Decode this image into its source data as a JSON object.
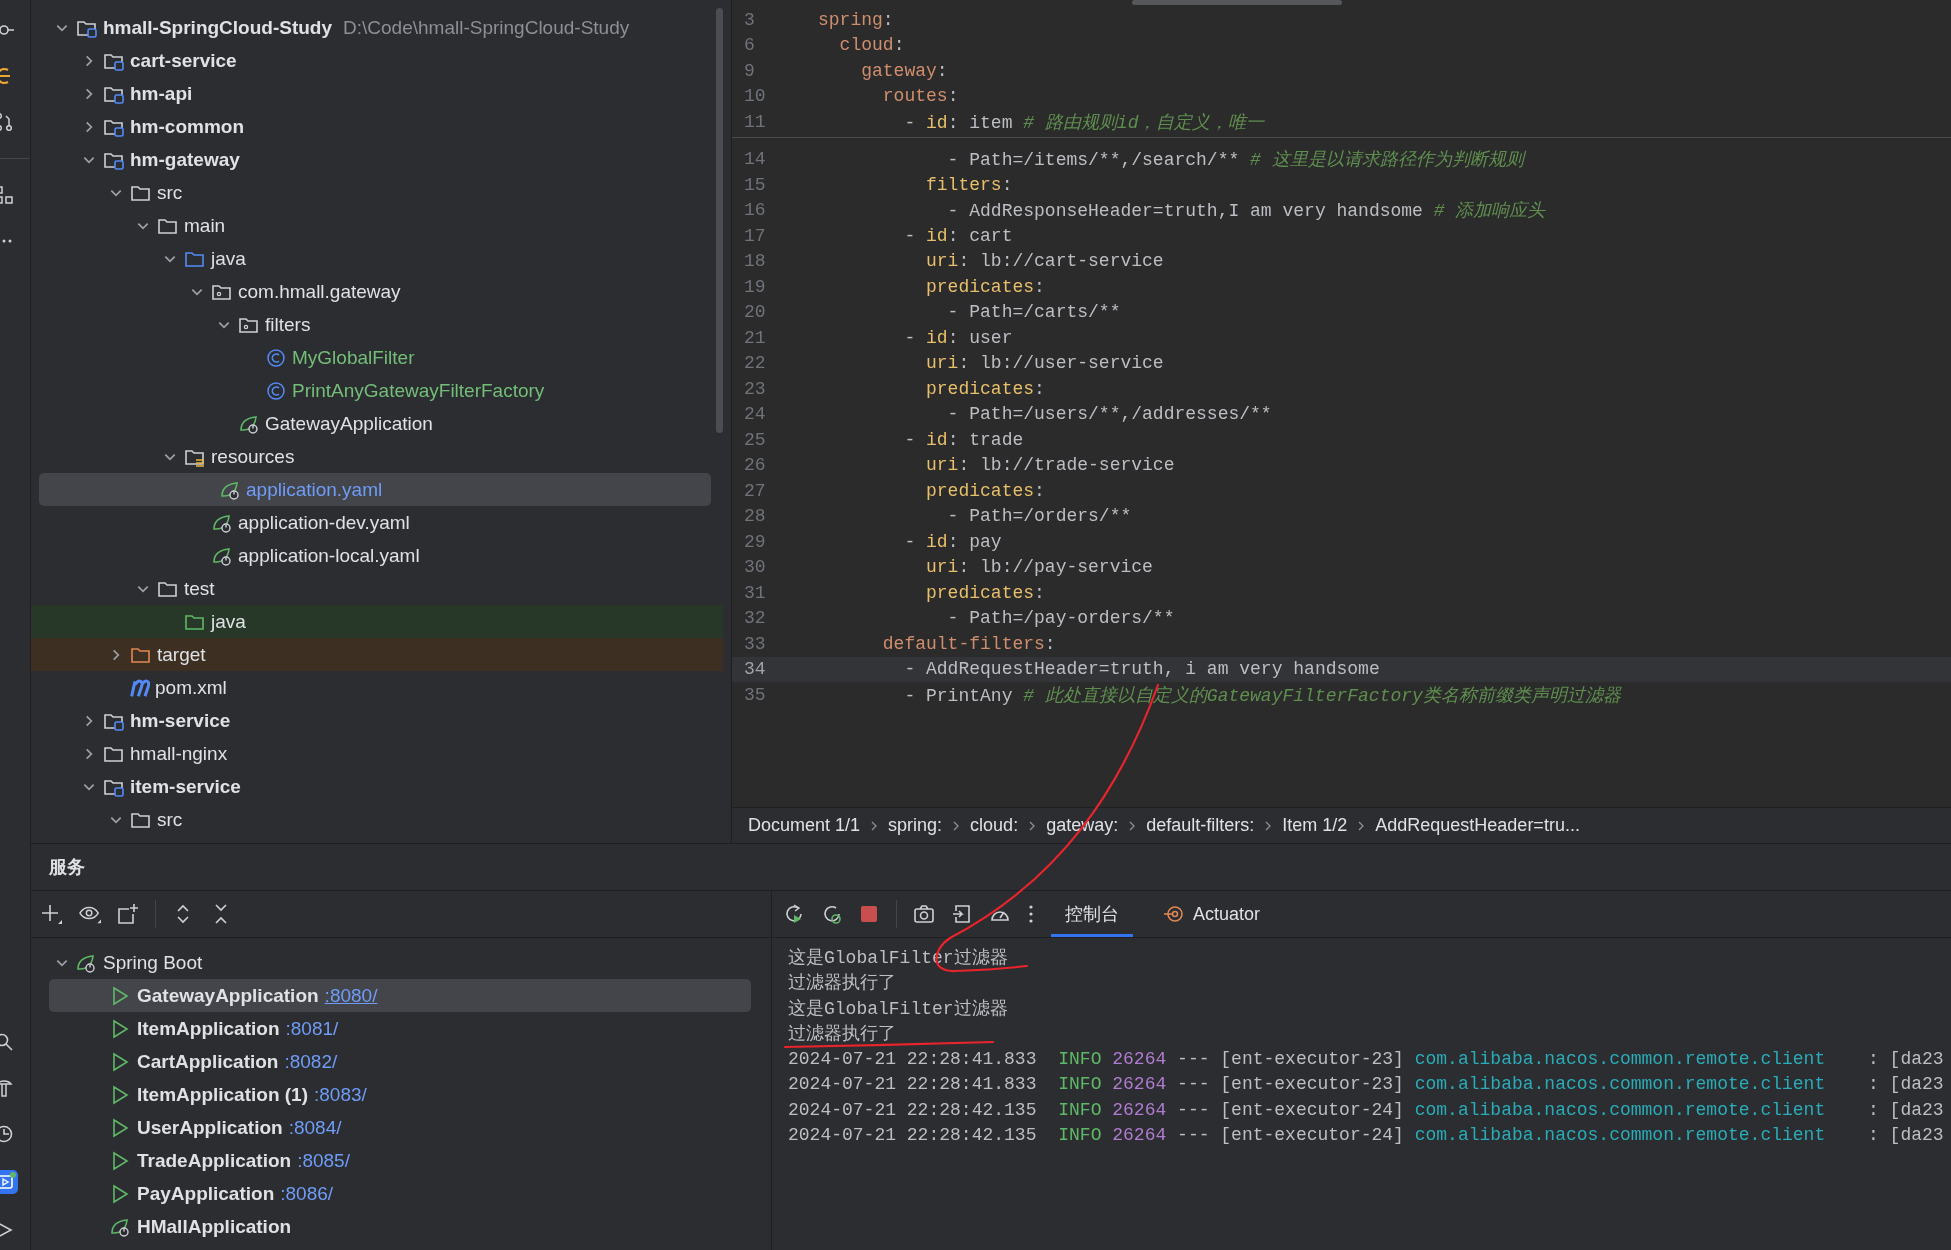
{
  "project_tree": [
    {
      "label": "hmall-SpringCloud-Study",
      "hint": "D:\\Code\\hmall-SpringCloud-Study",
      "kind": "module",
      "expanded": true,
      "selected": false,
      "children": [
        {
          "label": "cart-service",
          "kind": "module",
          "expanded": false,
          "selected": false
        },
        {
          "label": "hm-api",
          "kind": "module",
          "expanded": false,
          "selected": false
        },
        {
          "label": "hm-common",
          "kind": "module",
          "expanded": false,
          "selected": false
        },
        {
          "label": "hm-gateway",
          "kind": "module",
          "expanded": true,
          "selected": false,
          "children": [
            {
              "label": "src",
              "kind": "folder",
              "expanded": true,
              "selected": false,
              "children": [
                {
                  "label": "main",
                  "kind": "folder",
                  "expanded": true,
                  "selected": false,
                  "children": [
                    {
                      "label": "java",
                      "kind": "source-folder",
                      "expanded": true,
                      "selected": false,
                      "children": [
                        {
                          "label": "com.hmall.gateway",
                          "kind": "package",
                          "expanded": true,
                          "selected": false,
                          "children": [
                            {
                              "label": "filters",
                              "kind": "package",
                              "expanded": true,
                              "selected": false,
                              "children": [
                                {
                                  "label": "MyGlobalFilter",
                                  "kind": "class",
                                  "added": true,
                                  "modified": false,
                                  "selected": false
                                },
                                {
                                  "label": "PrintAnyGatewayFilterFactory",
                                  "kind": "class",
                                  "added": true,
                                  "modified": false,
                                  "selected": false
                                }
                              ]
                            },
                            {
                              "label": "GatewayApplication",
                              "kind": "spring-app",
                              "added": false,
                              "modified": false,
                              "selected": false
                            }
                          ]
                        }
                      ]
                    },
                    {
                      "label": "resources",
                      "kind": "resources",
                      "expanded": true,
                      "selected": false,
                      "children": [
                        {
                          "label": "application.yaml",
                          "kind": "spring-yaml",
                          "added": false,
                          "modified": true,
                          "selected": true
                        },
                        {
                          "label": "application-dev.yaml",
                          "kind": "spring-yaml",
                          "added": false,
                          "modified": false,
                          "selected": false
                        },
                        {
                          "label": "application-local.yaml",
                          "kind": "spring-yaml",
                          "added": false,
                          "modified": false,
                          "selected": false
                        }
                      ]
                    }
                  ]
                },
                {
                  "label": "test",
                  "kind": "folder",
                  "expanded": true,
                  "selected": false,
                  "children": [
                    {
                      "label": "java",
                      "kind": "test-folder",
                      "selected": false
                    }
                  ]
                }
              ]
            },
            {
              "label": "target",
              "kind": "excluded",
              "expanded": false,
              "selected": false
            },
            {
              "label": "pom.xml",
              "kind": "maven",
              "selected": false
            }
          ]
        },
        {
          "label": "hm-service",
          "kind": "module",
          "expanded": false,
          "selected": false
        },
        {
          "label": "hmall-nginx",
          "kind": "folder",
          "expanded": false,
          "selected": false
        },
        {
          "label": "item-service",
          "kind": "module",
          "expanded": true,
          "selected": false,
          "children": [
            {
              "label": "src",
              "kind": "folder",
              "expanded": true,
              "selected": false
            }
          ]
        }
      ]
    }
  ],
  "editor": {
    "sticky_lines": [
      {
        "n": "3",
        "parts": [
          {
            "t": "spring",
            "kind": "key"
          },
          {
            "t": ":",
            "kind": "text"
          }
        ]
      },
      {
        "n": "6",
        "parts": [
          {
            "t": "  cloud",
            "kind": "key"
          },
          {
            "t": ":",
            "kind": "text"
          }
        ]
      },
      {
        "n": "9",
        "parts": [
          {
            "t": "    gateway",
            "kind": "key"
          },
          {
            "t": ":",
            "kind": "text"
          }
        ]
      },
      {
        "n": "10",
        "parts": [
          {
            "t": "      routes",
            "kind": "key"
          },
          {
            "t": ":",
            "kind": "text"
          }
        ]
      },
      {
        "n": "11",
        "parts": [
          {
            "t": "        - ",
            "kind": "text"
          },
          {
            "t": "id",
            "kind": "key2"
          },
          {
            "t": ": item ",
            "kind": "text"
          },
          {
            "t": "# 路由规则id，自定义，唯一",
            "kind": "comment"
          }
        ]
      }
    ],
    "lines": [
      {
        "n": "14",
        "current": false,
        "parts": [
          {
            "t": "            - Path=/items/**,/search/** ",
            "kind": "text"
          },
          {
            "t": "# 这里是以请求路径作为判断规则",
            "kind": "comment"
          }
        ]
      },
      {
        "n": "15",
        "current": false,
        "parts": [
          {
            "t": "          filters",
            "kind": "key2"
          },
          {
            "t": ":",
            "kind": "text"
          }
        ]
      },
      {
        "n": "16",
        "current": false,
        "parts": [
          {
            "t": "            - AddResponseHeader=truth,I am very handsome ",
            "kind": "text"
          },
          {
            "t": "# 添加响应头",
            "kind": "comment"
          }
        ]
      },
      {
        "n": "17",
        "current": false,
        "parts": [
          {
            "t": "        - ",
            "kind": "text"
          },
          {
            "t": "id",
            "kind": "key2"
          },
          {
            "t": ": cart",
            "kind": "text"
          }
        ]
      },
      {
        "n": "18",
        "current": false,
        "parts": [
          {
            "t": "          uri",
            "kind": "key2"
          },
          {
            "t": ": lb://cart-service",
            "kind": "text"
          }
        ]
      },
      {
        "n": "19",
        "current": false,
        "parts": [
          {
            "t": "          predicates",
            "kind": "key2"
          },
          {
            "t": ":",
            "kind": "text"
          }
        ]
      },
      {
        "n": "20",
        "current": false,
        "parts": [
          {
            "t": "            - Path=/carts/**",
            "kind": "text"
          }
        ]
      },
      {
        "n": "21",
        "current": false,
        "parts": [
          {
            "t": "        - ",
            "kind": "text"
          },
          {
            "t": "id",
            "kind": "key2"
          },
          {
            "t": ": user",
            "kind": "text"
          }
        ]
      },
      {
        "n": "22",
        "current": false,
        "parts": [
          {
            "t": "          uri",
            "kind": "key2"
          },
          {
            "t": ": lb://user-service",
            "kind": "text"
          }
        ]
      },
      {
        "n": "23",
        "current": false,
        "parts": [
          {
            "t": "          predicates",
            "kind": "key2"
          },
          {
            "t": ":",
            "kind": "text"
          }
        ]
      },
      {
        "n": "24",
        "current": false,
        "parts": [
          {
            "t": "            - Path=/users/**,/addresses/**",
            "kind": "text"
          }
        ]
      },
      {
        "n": "25",
        "current": false,
        "parts": [
          {
            "t": "        - ",
            "kind": "text"
          },
          {
            "t": "id",
            "kind": "key2"
          },
          {
            "t": ": trade",
            "kind": "text"
          }
        ]
      },
      {
        "n": "26",
        "current": false,
        "parts": [
          {
            "t": "          uri",
            "kind": "key2"
          },
          {
            "t": ": lb://trade-service",
            "kind": "text"
          }
        ]
      },
      {
        "n": "27",
        "current": false,
        "parts": [
          {
            "t": "          predicates",
            "kind": "key2"
          },
          {
            "t": ":",
            "kind": "text"
          }
        ]
      },
      {
        "n": "28",
        "current": false,
        "parts": [
          {
            "t": "            - Path=/orders/**",
            "kind": "text"
          }
        ]
      },
      {
        "n": "29",
        "current": false,
        "parts": [
          {
            "t": "        - ",
            "kind": "text"
          },
          {
            "t": "id",
            "kind": "key2"
          },
          {
            "t": ": pay",
            "kind": "text"
          }
        ]
      },
      {
        "n": "30",
        "current": false,
        "parts": [
          {
            "t": "          uri",
            "kind": "key2"
          },
          {
            "t": ": lb://pay-service",
            "kind": "text"
          }
        ]
      },
      {
        "n": "31",
        "current": false,
        "parts": [
          {
            "t": "          predicates",
            "kind": "key2"
          },
          {
            "t": ":",
            "kind": "text"
          }
        ]
      },
      {
        "n": "32",
        "current": false,
        "parts": [
          {
            "t": "            - Path=/pay-orders/**",
            "kind": "text"
          }
        ]
      },
      {
        "n": "33",
        "current": false,
        "parts": [
          {
            "t": "      default-filters",
            "kind": "key"
          },
          {
            "t": ":",
            "kind": "text"
          }
        ]
      },
      {
        "n": "34",
        "current": true,
        "parts": [
          {
            "t": "        - AddRequestHeader=truth, i am very handsome",
            "kind": "text"
          }
        ]
      },
      {
        "n": "35",
        "current": false,
        "parts": [
          {
            "t": "        - PrintAny ",
            "kind": "text"
          },
          {
            "t": "# 此处直接以自定义的GatewayFilterFactory类名称前缀类声明过滤器",
            "kind": "comment"
          }
        ]
      }
    ]
  },
  "breadcrumb": [
    "Document 1/1",
    "spring:",
    "cloud:",
    "gateway:",
    "default-filters:",
    "Item 1/2",
    "AddRequestHeader=tru..."
  ],
  "services": {
    "title": "服务",
    "group": {
      "label": "Spring Boot",
      "expanded": true,
      "items": [
        {
          "name": "GatewayApplication",
          "port": ":8080/",
          "kind": "run-config",
          "selected": true
        },
        {
          "name": "ItemApplication",
          "port": ":8081/",
          "kind": "run-config",
          "selected": false
        },
        {
          "name": "CartApplication",
          "port": ":8082/",
          "kind": "run-config",
          "selected": false
        },
        {
          "name": "ItemApplication (1)",
          "port": ":8083/",
          "kind": "run-config",
          "selected": false
        },
        {
          "name": "UserApplication",
          "port": ":8084/",
          "kind": "run-config",
          "selected": false
        },
        {
          "name": "TradeApplication",
          "port": ":8085/",
          "kind": "run-config",
          "selected": false
        },
        {
          "name": "PayApplication",
          "port": ":8086/",
          "kind": "run-config",
          "selected": false
        },
        {
          "name": "HMallApplication",
          "kind": "spring-app",
          "selected": false
        }
      ]
    }
  },
  "console": {
    "tabs": [
      {
        "label": "控制台",
        "selected": true
      },
      {
        "label": "Actuator",
        "selected": false
      }
    ],
    "lines": [
      {
        "kind": "plain",
        "text": "这是GlobalFilter过滤器"
      },
      {
        "kind": "plain",
        "text": "过滤器执行了"
      },
      {
        "kind": "plain",
        "text": "这是GlobalFilter过滤器"
      },
      {
        "kind": "plain",
        "text": "过滤器执行了"
      },
      {
        "kind": "log",
        "time": "2024-07-21 22:28:41.833",
        "level": "INFO",
        "pid": "26264",
        "sep": "---",
        "thread": "[ent-executor-23]",
        "logger": "com.alibaba.nacos.common.remote.client",
        "message": ": [da23"
      },
      {
        "kind": "log",
        "time": "2024-07-21 22:28:41.833",
        "level": "INFO",
        "pid": "26264",
        "sep": "---",
        "thread": "[ent-executor-23]",
        "logger": "com.alibaba.nacos.common.remote.client",
        "message": ": [da23"
      },
      {
        "kind": "log",
        "time": "2024-07-21 22:28:42.135",
        "level": "INFO",
        "pid": "26264",
        "sep": "---",
        "thread": "[ent-executor-24]",
        "logger": "com.alibaba.nacos.common.remote.client",
        "message": ": [da23"
      },
      {
        "kind": "log",
        "time": "2024-07-21 22:28:42.135",
        "level": "INFO",
        "pid": "26264",
        "sep": "---",
        "thread": "[ent-executor-24]",
        "logger": "com.alibaba.nacos.common.remote.client",
        "message": ": [da23"
      }
    ]
  }
}
